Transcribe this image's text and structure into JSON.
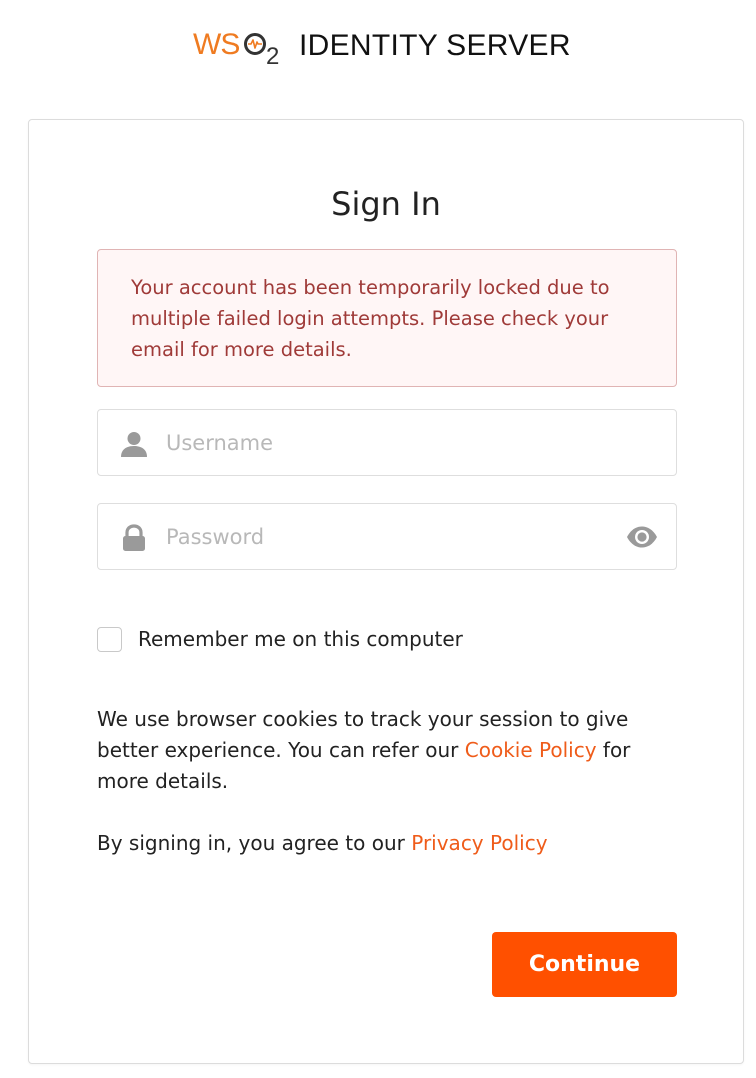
{
  "header": {
    "logo_ws": "WS",
    "logo_two": "2",
    "product_name": "IDENTITY SERVER"
  },
  "signin": {
    "title": "Sign In",
    "alert": "Your account has been temporarily locked due to multiple failed login attempts. Please check your email for more details.",
    "username_placeholder": "Username",
    "username_value": "",
    "password_placeholder": "Password",
    "password_value": "",
    "remember_label": "Remember me on this computer",
    "remember_checked": false,
    "cookie_text_before": "We use browser cookies to track your session to give better experience. You can refer our ",
    "cookie_link": "Cookie Policy",
    "cookie_text_after": " for more details.",
    "privacy_text_before": "By signing in, you agree to our ",
    "privacy_link": "Privacy Policy",
    "continue_label": "Continue"
  },
  "icons": {
    "username_field": "user-icon",
    "password_field": "lock-icon",
    "password_toggle": "eye-icon"
  },
  "colors": {
    "brand_orange": "#ff5000",
    "link_orange": "#ef5c1a",
    "logo_orange": "#ef7b21",
    "alert_text": "#9f3a38",
    "alert_background": "#fff6f6",
    "alert_border": "#e0b4b4"
  }
}
